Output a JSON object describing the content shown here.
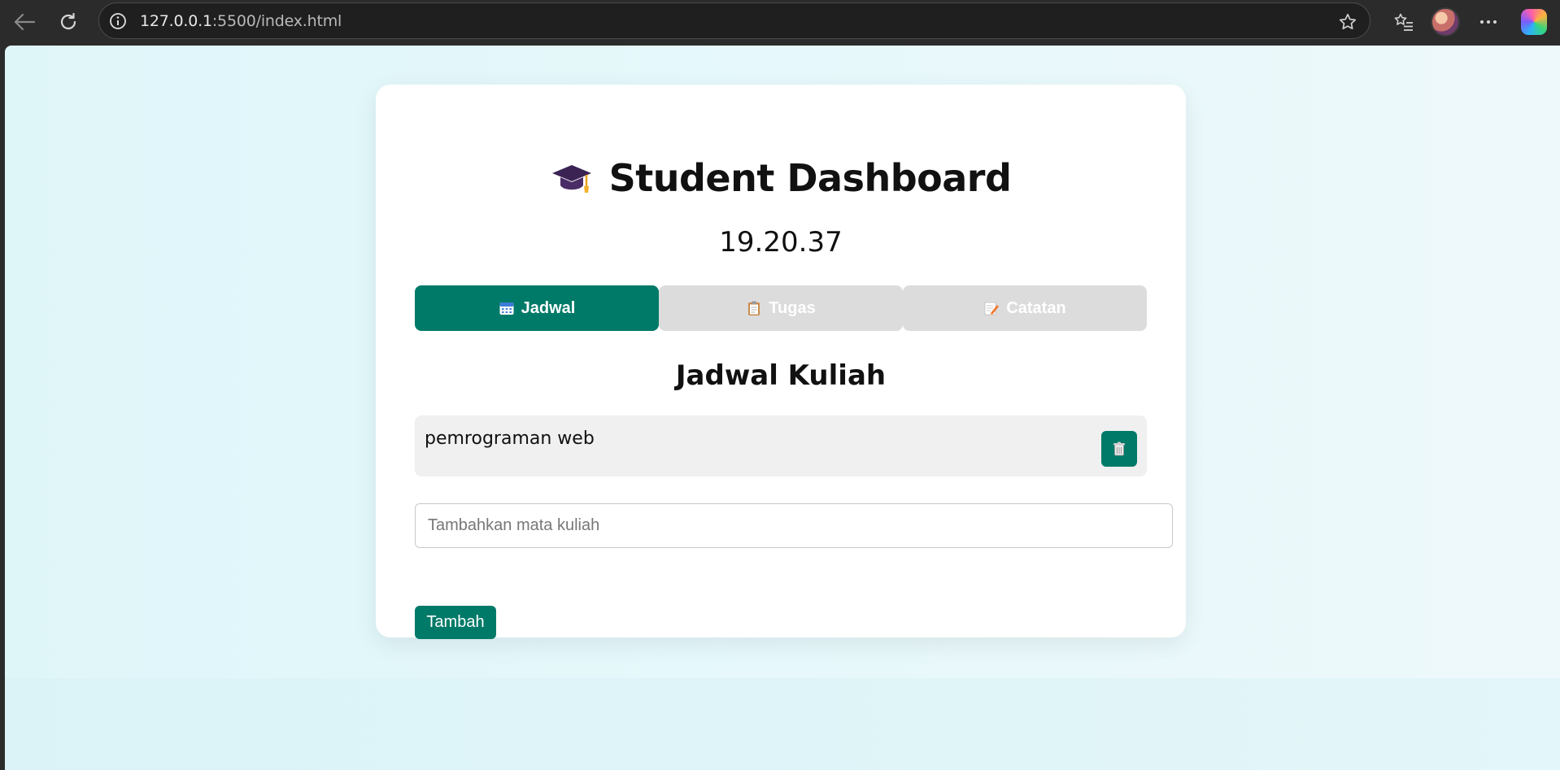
{
  "browser": {
    "url_host": "127.0.0.1",
    "url_rest": ":5500/index.html"
  },
  "app": {
    "title": "Student Dashboard",
    "clock": "19.20.37"
  },
  "tabs": [
    {
      "label": "Jadwal",
      "icon": "calendar-icon",
      "active": true
    },
    {
      "label": "Tugas",
      "icon": "clipboard-icon",
      "active": false
    },
    {
      "label": "Catatan",
      "icon": "memo-icon",
      "active": false
    }
  ],
  "section": {
    "title": "Jadwal Kuliah"
  },
  "schedule": {
    "items": [
      {
        "text": "pemrograman web"
      }
    ]
  },
  "form": {
    "placeholder": "Tambahkan mata kuliah",
    "value": "",
    "button_label": "Tambah"
  },
  "colors": {
    "accent": "#007a68",
    "tab_inactive": "#dcdcdc",
    "background": "#e6f8fb"
  }
}
